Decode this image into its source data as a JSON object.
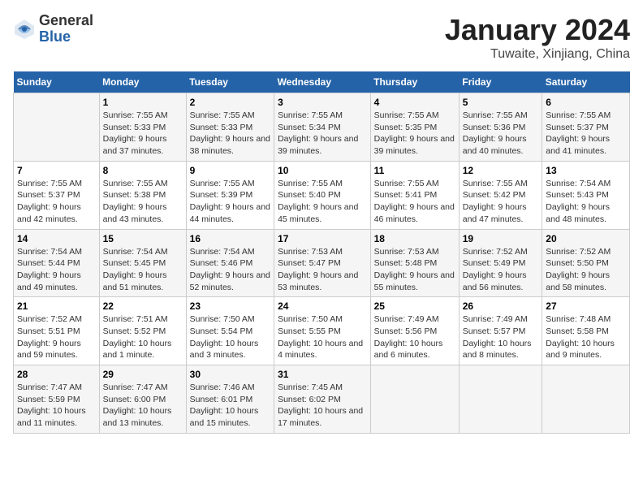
{
  "logo": {
    "general": "General",
    "blue": "Blue"
  },
  "title": "January 2024",
  "subtitle": "Tuwaite, Xinjiang, China",
  "headers": [
    "Sunday",
    "Monday",
    "Tuesday",
    "Wednesday",
    "Thursday",
    "Friday",
    "Saturday"
  ],
  "weeks": [
    [
      {
        "day": "",
        "sunrise": "",
        "sunset": "",
        "daylight": ""
      },
      {
        "day": "1",
        "sunrise": "Sunrise: 7:55 AM",
        "sunset": "Sunset: 5:33 PM",
        "daylight": "Daylight: 9 hours and 37 minutes."
      },
      {
        "day": "2",
        "sunrise": "Sunrise: 7:55 AM",
        "sunset": "Sunset: 5:33 PM",
        "daylight": "Daylight: 9 hours and 38 minutes."
      },
      {
        "day": "3",
        "sunrise": "Sunrise: 7:55 AM",
        "sunset": "Sunset: 5:34 PM",
        "daylight": "Daylight: 9 hours and 39 minutes."
      },
      {
        "day": "4",
        "sunrise": "Sunrise: 7:55 AM",
        "sunset": "Sunset: 5:35 PM",
        "daylight": "Daylight: 9 hours and 39 minutes."
      },
      {
        "day": "5",
        "sunrise": "Sunrise: 7:55 AM",
        "sunset": "Sunset: 5:36 PM",
        "daylight": "Daylight: 9 hours and 40 minutes."
      },
      {
        "day": "6",
        "sunrise": "Sunrise: 7:55 AM",
        "sunset": "Sunset: 5:37 PM",
        "daylight": "Daylight: 9 hours and 41 minutes."
      }
    ],
    [
      {
        "day": "7",
        "sunrise": "Sunrise: 7:55 AM",
        "sunset": "Sunset: 5:37 PM",
        "daylight": "Daylight: 9 hours and 42 minutes."
      },
      {
        "day": "8",
        "sunrise": "Sunrise: 7:55 AM",
        "sunset": "Sunset: 5:38 PM",
        "daylight": "Daylight: 9 hours and 43 minutes."
      },
      {
        "day": "9",
        "sunrise": "Sunrise: 7:55 AM",
        "sunset": "Sunset: 5:39 PM",
        "daylight": "Daylight: 9 hours and 44 minutes."
      },
      {
        "day": "10",
        "sunrise": "Sunrise: 7:55 AM",
        "sunset": "Sunset: 5:40 PM",
        "daylight": "Daylight: 9 hours and 45 minutes."
      },
      {
        "day": "11",
        "sunrise": "Sunrise: 7:55 AM",
        "sunset": "Sunset: 5:41 PM",
        "daylight": "Daylight: 9 hours and 46 minutes."
      },
      {
        "day": "12",
        "sunrise": "Sunrise: 7:55 AM",
        "sunset": "Sunset: 5:42 PM",
        "daylight": "Daylight: 9 hours and 47 minutes."
      },
      {
        "day": "13",
        "sunrise": "Sunrise: 7:54 AM",
        "sunset": "Sunset: 5:43 PM",
        "daylight": "Daylight: 9 hours and 48 minutes."
      }
    ],
    [
      {
        "day": "14",
        "sunrise": "Sunrise: 7:54 AM",
        "sunset": "Sunset: 5:44 PM",
        "daylight": "Daylight: 9 hours and 49 minutes."
      },
      {
        "day": "15",
        "sunrise": "Sunrise: 7:54 AM",
        "sunset": "Sunset: 5:45 PM",
        "daylight": "Daylight: 9 hours and 51 minutes."
      },
      {
        "day": "16",
        "sunrise": "Sunrise: 7:54 AM",
        "sunset": "Sunset: 5:46 PM",
        "daylight": "Daylight: 9 hours and 52 minutes."
      },
      {
        "day": "17",
        "sunrise": "Sunrise: 7:53 AM",
        "sunset": "Sunset: 5:47 PM",
        "daylight": "Daylight: 9 hours and 53 minutes."
      },
      {
        "day": "18",
        "sunrise": "Sunrise: 7:53 AM",
        "sunset": "Sunset: 5:48 PM",
        "daylight": "Daylight: 9 hours and 55 minutes."
      },
      {
        "day": "19",
        "sunrise": "Sunrise: 7:52 AM",
        "sunset": "Sunset: 5:49 PM",
        "daylight": "Daylight: 9 hours and 56 minutes."
      },
      {
        "day": "20",
        "sunrise": "Sunrise: 7:52 AM",
        "sunset": "Sunset: 5:50 PM",
        "daylight": "Daylight: 9 hours and 58 minutes."
      }
    ],
    [
      {
        "day": "21",
        "sunrise": "Sunrise: 7:52 AM",
        "sunset": "Sunset: 5:51 PM",
        "daylight": "Daylight: 9 hours and 59 minutes."
      },
      {
        "day": "22",
        "sunrise": "Sunrise: 7:51 AM",
        "sunset": "Sunset: 5:52 PM",
        "daylight": "Daylight: 10 hours and 1 minute."
      },
      {
        "day": "23",
        "sunrise": "Sunrise: 7:50 AM",
        "sunset": "Sunset: 5:54 PM",
        "daylight": "Daylight: 10 hours and 3 minutes."
      },
      {
        "day": "24",
        "sunrise": "Sunrise: 7:50 AM",
        "sunset": "Sunset: 5:55 PM",
        "daylight": "Daylight: 10 hours and 4 minutes."
      },
      {
        "day": "25",
        "sunrise": "Sunrise: 7:49 AM",
        "sunset": "Sunset: 5:56 PM",
        "daylight": "Daylight: 10 hours and 6 minutes."
      },
      {
        "day": "26",
        "sunrise": "Sunrise: 7:49 AM",
        "sunset": "Sunset: 5:57 PM",
        "daylight": "Daylight: 10 hours and 8 minutes."
      },
      {
        "day": "27",
        "sunrise": "Sunrise: 7:48 AM",
        "sunset": "Sunset: 5:58 PM",
        "daylight": "Daylight: 10 hours and 9 minutes."
      }
    ],
    [
      {
        "day": "28",
        "sunrise": "Sunrise: 7:47 AM",
        "sunset": "Sunset: 5:59 PM",
        "daylight": "Daylight: 10 hours and 11 minutes."
      },
      {
        "day": "29",
        "sunrise": "Sunrise: 7:47 AM",
        "sunset": "Sunset: 6:00 PM",
        "daylight": "Daylight: 10 hours and 13 minutes."
      },
      {
        "day": "30",
        "sunrise": "Sunrise: 7:46 AM",
        "sunset": "Sunset: 6:01 PM",
        "daylight": "Daylight: 10 hours and 15 minutes."
      },
      {
        "day": "31",
        "sunrise": "Sunrise: 7:45 AM",
        "sunset": "Sunset: 6:02 PM",
        "daylight": "Daylight: 10 hours and 17 minutes."
      },
      {
        "day": "",
        "sunrise": "",
        "sunset": "",
        "daylight": ""
      },
      {
        "day": "",
        "sunrise": "",
        "sunset": "",
        "daylight": ""
      },
      {
        "day": "",
        "sunrise": "",
        "sunset": "",
        "daylight": ""
      }
    ]
  ]
}
